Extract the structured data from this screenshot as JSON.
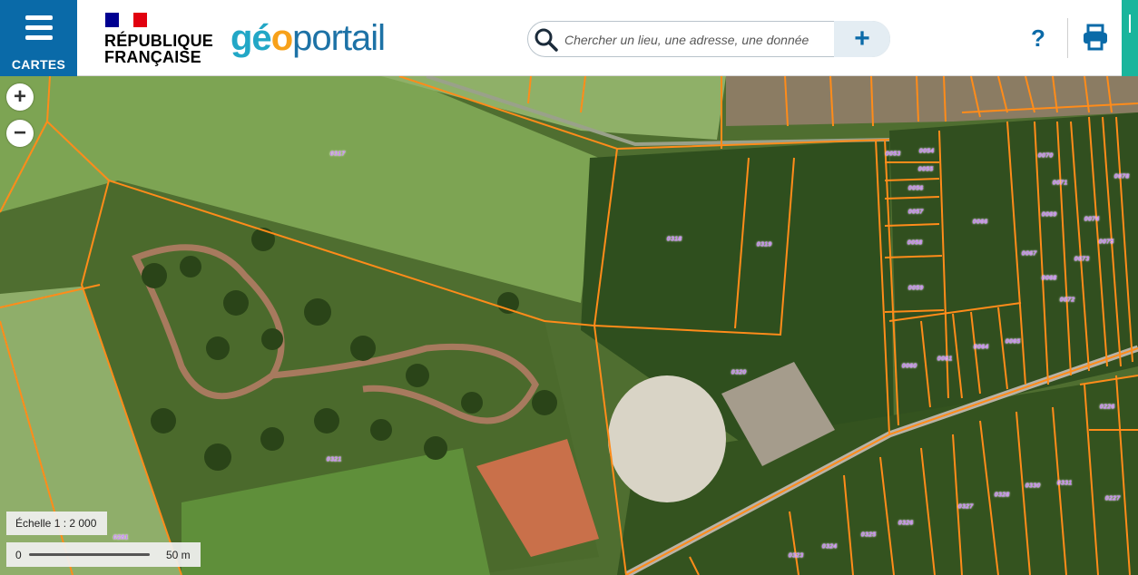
{
  "header": {
    "menu_label": "CARTES",
    "rf_line1": "RÉPUBLIQUE",
    "rf_line2": "FRANÇAISE",
    "brand_geo1": "gé",
    "brand_geo2": "o",
    "brand_portail": "portail",
    "search_placeholder": "Chercher un lieu, une adresse, une donnée",
    "help_label": "?",
    "icons": [
      "menu-icon",
      "marianne-logo",
      "search-icon",
      "plus-icon",
      "help-icon",
      "print-icon"
    ]
  },
  "map_controls": {
    "zoom_in": "+",
    "zoom_out": "−",
    "scale_text": "Échelle 1 : 2 000",
    "scale_zero": "0",
    "scale_dist": "50 m"
  },
  "parcels": {
    "labels": [
      "0317",
      "0318",
      "0319",
      "0320",
      "0321",
      "0053",
      "0054",
      "0055",
      "0056",
      "0057",
      "0058",
      "0059",
      "0060",
      "0061",
      "0064",
      "0065",
      "0066",
      "0067",
      "0068",
      "0069",
      "0070",
      "0071",
      "0072",
      "0073",
      "0074",
      "0075",
      "0078",
      "0226",
      "0227",
      "0281",
      "0323",
      "0324",
      "0325",
      "0326",
      "0327",
      "0328",
      "0330",
      "0331"
    ]
  },
  "colors": {
    "brand_blue": "#0a6aa8",
    "geo_cyan": "#22a7c6",
    "geo_orange": "#f7a11a",
    "parcel_line": "#ff8c1a",
    "parcel_label": "#c47cf4",
    "accent_green": "#19b59c"
  }
}
